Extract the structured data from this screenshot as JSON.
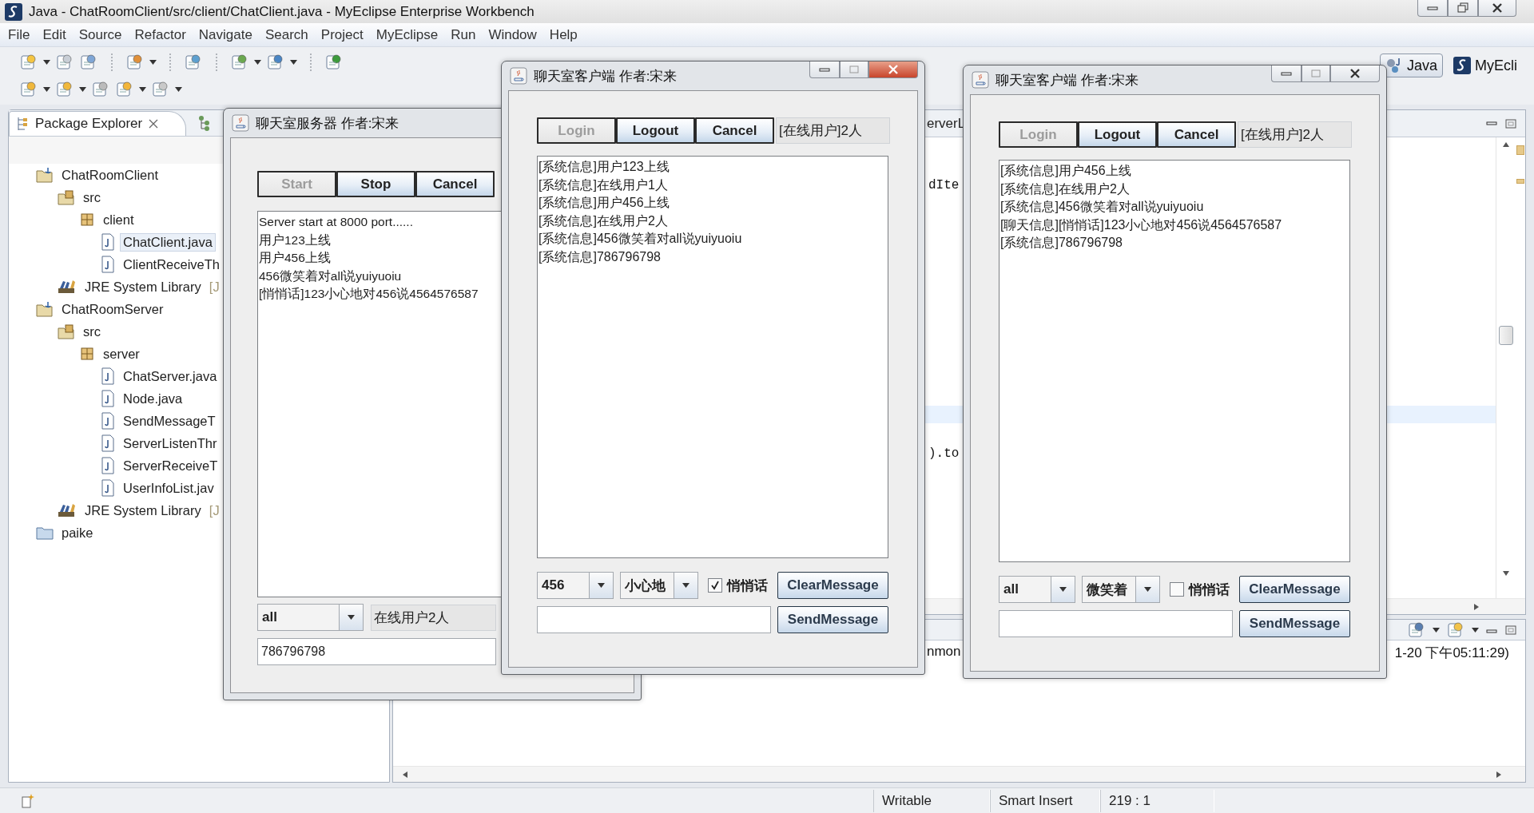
{
  "window": {
    "title": "Java - ChatRoomClient/src/client/ChatClient.java - MyEclipse Enterprise Workbench"
  },
  "menu": [
    "File",
    "Edit",
    "Source",
    "Refactor",
    "Navigate",
    "Search",
    "Project",
    "MyEclipse",
    "Run",
    "Window",
    "Help"
  ],
  "perspectives": [
    {
      "label": "Java",
      "selected": true
    },
    {
      "label": "MyEcli",
      "selected": false
    }
  ],
  "package_explorer": {
    "tab": "Package Explorer",
    "tree": [
      {
        "label": "ChatRoomClient",
        "kind": "project",
        "selected": false,
        "children": [
          {
            "label": "src",
            "kind": "source",
            "selected": false,
            "children": [
              {
                "label": "client",
                "kind": "package",
                "selected": false,
                "children": [
                  {
                    "label": "ChatClient.java",
                    "kind": "file",
                    "selected": true
                  },
                  {
                    "label": "ClientReceiveTh",
                    "kind": "file",
                    "selected": false
                  }
                ]
              }
            ]
          },
          {
            "label": "JRE System Library",
            "decoration": "[J",
            "kind": "library",
            "selected": false
          }
        ]
      },
      {
        "label": "ChatRoomServer",
        "kind": "project",
        "selected": false,
        "children": [
          {
            "label": "src",
            "kind": "source",
            "selected": false,
            "children": [
              {
                "label": "server",
                "kind": "package",
                "selected": false,
                "children": [
                  {
                    "label": "ChatServer.java",
                    "kind": "file",
                    "selected": false
                  },
                  {
                    "label": "Node.java",
                    "kind": "file",
                    "selected": false
                  },
                  {
                    "label": "SendMessageT",
                    "kind": "file",
                    "selected": false
                  },
                  {
                    "label": "ServerListenThr",
                    "kind": "file",
                    "selected": false
                  },
                  {
                    "label": "ServerReceiveT",
                    "kind": "file",
                    "selected": false
                  },
                  {
                    "label": "UserInfoList.jav",
                    "kind": "file",
                    "selected": false
                  }
                ]
              }
            ]
          },
          {
            "label": "JRE System Library",
            "decoration": "[J",
            "kind": "library",
            "selected": false
          }
        ]
      },
      {
        "label": "paike",
        "kind": "folder",
        "selected": false
      }
    ]
  },
  "editor": {
    "tab": "erverL",
    "code": [
      "dIte",
      ").to"
    ]
  },
  "console": {
    "text": [
      "nmon",
      "1-20 下午05:11:29)"
    ]
  },
  "status_bar": [
    "Writable",
    "Smart Insert",
    "219 : 1"
  ],
  "server_window": {
    "title": "聊天室服务器 作者:宋来",
    "buttons": [
      {
        "label": "Start",
        "disabled": true
      },
      {
        "label": "Stop",
        "disabled": false
      },
      {
        "label": "Cancel",
        "disabled": false
      }
    ],
    "log": [
      "Server start at 8000 port......",
      "用户123上线",
      "用户456上线",
      "456微笑着对all说yuiyuoiu",
      "[悄悄话]123小心地对456说4564576587"
    ],
    "target": "all",
    "online": "在线用户2人",
    "message": "786796798"
  },
  "client_windows": [
    {
      "title": "聊天室客户端 作者:宋来",
      "active": true,
      "buttons": [
        {
          "label": "Login",
          "disabled": true
        },
        {
          "label": "Logout",
          "disabled": false
        },
        {
          "label": "Cancel",
          "disabled": false
        }
      ],
      "online": "[在线用户]2人",
      "log": [
        "[系统信息]用户123上线",
        "[系统信息]在线用户1人",
        "[系统信息]用户456上线",
        "[系统信息]在线用户2人",
        "[系统信息]456微笑着对all说yuiyuoiu",
        "[系统信息]786796798"
      ],
      "target": "456",
      "manner": "小心地",
      "whisper": {
        "label": "悄悄话",
        "checked": true
      },
      "actions": [
        "ClearMessage",
        "SendMessage"
      ]
    },
    {
      "title": "聊天室客户端 作者:宋来",
      "active": false,
      "buttons": [
        {
          "label": "Login",
          "disabled": true
        },
        {
          "label": "Logout",
          "disabled": false
        },
        {
          "label": "Cancel",
          "disabled": false
        }
      ],
      "online": "[在线用户]2人",
      "log": [
        "[系统信息]用户456上线",
        "[系统信息]在线用户2人",
        "[系统信息]456微笑着对all说yuiyuoiu",
        "[聊天信息][悄悄话]123小心地对456说4564576587",
        "[系统信息]786796798"
      ],
      "target": "all",
      "manner": "微笑着",
      "whisper": {
        "label": "悄悄话",
        "checked": false
      },
      "actions": [
        "ClearMessage",
        "SendMessage"
      ]
    }
  ]
}
